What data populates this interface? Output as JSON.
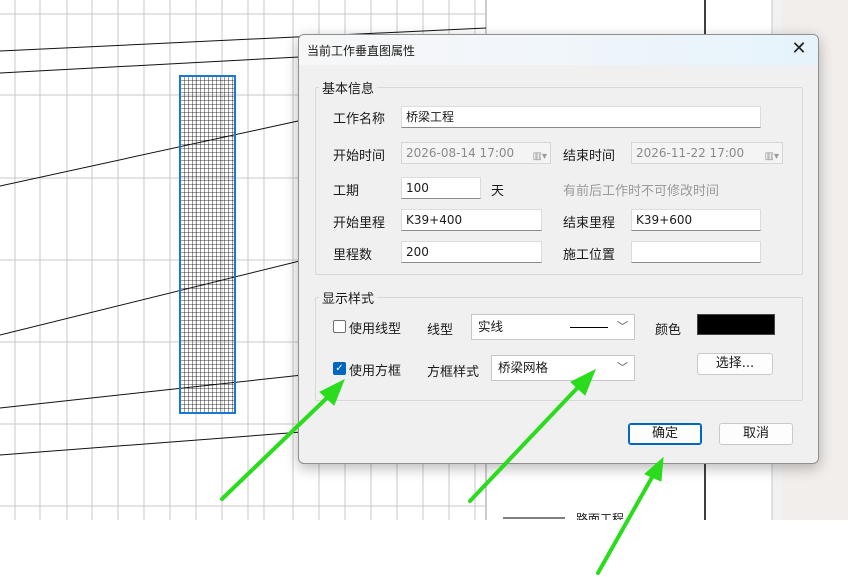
{
  "dialog": {
    "title": "当前工作垂直图属性",
    "close_glyph": "✕",
    "basic_info": {
      "legend": "基本信息",
      "name_label": "工作名称",
      "name_value": "桥梁工程",
      "start_label": "开始时间",
      "start_value": "2026-08-14 17:00",
      "end_label": "结束时间",
      "end_value": "2026-11-22 17:00",
      "duration_label": "工期",
      "duration_value": "100",
      "duration_unit": "天",
      "hint": "有前后工作时不可修改时间",
      "start_mileage_label": "开始里程",
      "start_mileage_value": "K39+400",
      "end_mileage_label": "结束里程",
      "end_mileage_value": "K39+600",
      "mileage_count_label": "里程数",
      "mileage_count_value": "200",
      "location_label": "施工位置",
      "location_value": ""
    },
    "display_style": {
      "legend": "显示样式",
      "use_line_label": "使用线型",
      "use_line_checked": false,
      "line_type_label": "线型",
      "line_type_value": "实线",
      "color_label": "颜色",
      "color_value": "#000000",
      "use_box_label": "使用方框",
      "use_box_checked": true,
      "box_style_label": "方框样式",
      "box_style_value": "桥梁网格",
      "choose_button": "选择..."
    },
    "ok_button": "确定",
    "cancel_button": "取消"
  },
  "background": {
    "legend_text": "路面工程"
  },
  "colors": {
    "accent": "#0067c0",
    "annotation_arrow": "#2bdc1e"
  }
}
